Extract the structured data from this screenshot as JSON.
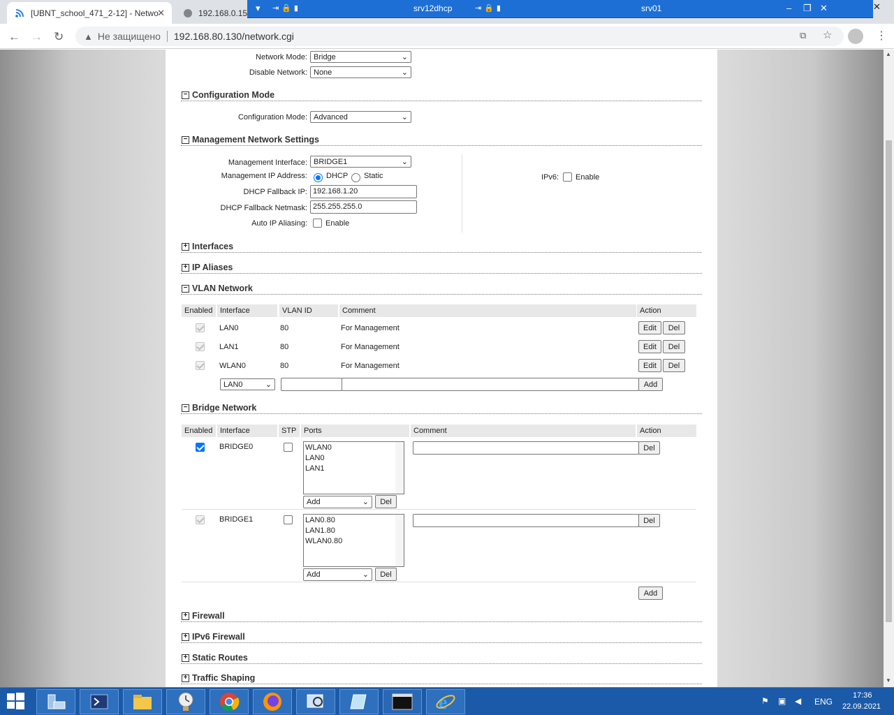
{
  "browser": {
    "tabs": [
      {
        "title": "[UBNT_school_471_2-12] - Netwo",
        "active": true
      },
      {
        "title": "192.168.0.15",
        "active": false
      }
    ],
    "address_security": "Не защищено",
    "url": "192.168.80.130/network.cgi"
  },
  "rdp": {
    "session1": "srv12dhcp",
    "session2": "srv01"
  },
  "network": {
    "mode_label": "Network Mode:",
    "mode_value": "Bridge",
    "disable_label": "Disable Network:",
    "disable_value": "None"
  },
  "sections": {
    "config_mode": "Configuration Mode",
    "management": "Management Network Settings",
    "interfaces": "Interfaces",
    "ip_aliases": "IP Aliases",
    "vlan": "VLAN Network",
    "bridge": "Bridge Network",
    "firewall": "Firewall",
    "ipv6_firewall": "IPv6 Firewall",
    "static_routes": "Static Routes",
    "traffic_shaping": "Traffic Shaping"
  },
  "config": {
    "label": "Configuration Mode:",
    "value": "Advanced"
  },
  "management": {
    "iface_label": "Management Interface:",
    "iface_value": "BRIDGE1",
    "ip_label": "Management IP Address:",
    "dhcp": "DHCP",
    "static": "Static",
    "fallback_ip_label": "DHCP Fallback IP:",
    "fallback_ip": "192.168.1.20",
    "fallback_mask_label": "DHCP Fallback Netmask:",
    "fallback_mask": "255.255.255.0",
    "alias_label": "Auto IP Aliasing:",
    "enable": "Enable",
    "ipv6_label": "IPv6:",
    "ipv6_enable": "Enable"
  },
  "vlan": {
    "headers": [
      "Enabled",
      "Interface",
      "VLAN ID",
      "Comment",
      "Action"
    ],
    "rows": [
      {
        "iface": "LAN0",
        "id": "80",
        "comment": "For Management"
      },
      {
        "iface": "LAN1",
        "id": "80",
        "comment": "For Management"
      },
      {
        "iface": "WLAN0",
        "id": "80",
        "comment": "For Management"
      }
    ],
    "edit": "Edit",
    "del": "Del",
    "new_iface": "LAN0",
    "add": "Add"
  },
  "bridge": {
    "headers": [
      "Enabled",
      "Interface",
      "STP",
      "Ports",
      "Comment",
      "Action"
    ],
    "rows": [
      {
        "iface": "BRIDGE0",
        "enabled": true,
        "ports": [
          "WLAN0",
          "LAN0",
          "LAN1"
        ]
      },
      {
        "iface": "BRIDGE1",
        "enabled": false,
        "ports": [
          "LAN0.80",
          "LAN1.80",
          "WLAN0.80"
        ]
      }
    ],
    "port_add": "Add",
    "del": "Del",
    "add": "Add"
  },
  "taskbar": {
    "lang": "ENG",
    "time": "17:36",
    "date": "22.09.2021"
  }
}
